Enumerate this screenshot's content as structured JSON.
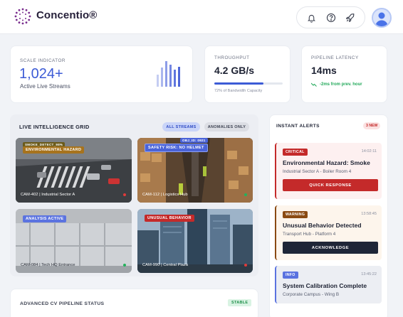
{
  "brand": {
    "name": "Concentio®"
  },
  "header_icons": [
    "bell-icon",
    "help-icon",
    "rocket-icon"
  ],
  "stats": {
    "scale": {
      "label": "SCALE INDICATOR",
      "value": "1,024+",
      "sub": "Active Live Streams"
    },
    "throughput": {
      "label": "THROUGHPUT",
      "value": "4.2 GB/s",
      "sub": "72% of Bandwidth Capacity",
      "fill_pct": 72
    },
    "latency": {
      "label": "PIPELINE LATENCY",
      "value": "14ms",
      "delta": "-2ms from prev. hour"
    }
  },
  "grid": {
    "title": "LIVE INTELLIGENCE GRID",
    "filters": [
      "ALL STREAMS",
      "ANOMALIES ONLY"
    ],
    "tiles": [
      {
        "tag": "ENVIRONMENTAL HAZARD",
        "detect": "SMOKE_DETECT_98%",
        "caption": "CAM-402 | Industrial Sector A",
        "status": "red"
      },
      {
        "tag": "SAFETY RISK: NO HELMET",
        "detect": "OBJ_ID: 0921",
        "caption": "CAM-112 | Logistics Hub",
        "status": "green"
      },
      {
        "tag": "ANALYSIS ACTIVE",
        "detect": "",
        "caption": "CAM-084 | Tech HQ Entrance",
        "status": "green"
      },
      {
        "tag": "UNUSUAL BEHAVIOR",
        "detect": "",
        "caption": "CAM-990 | Central Plaza",
        "status": "red"
      }
    ]
  },
  "alerts": {
    "title": "INSTANT ALERTS",
    "count": "3 NEW",
    "items": [
      {
        "level": "CRITICAL",
        "time": "14:02:11",
        "title": "Environmental Hazard: Smoke",
        "location": "Industrial Sector A - Boiler Room 4",
        "action": "QUICK RESPONSE"
      },
      {
        "level": "WARNING",
        "time": "13:58:45",
        "title": "Unusual Behavior Detected",
        "location": "Transport Hub - Platform 4",
        "action": "ACKNOWLEDGE"
      },
      {
        "level": "INFO",
        "time": "13:45:22",
        "title": "System Calibration Complete",
        "location": "Corporate Campus - Wing B",
        "action": ""
      }
    ]
  },
  "pipeline": {
    "title": "ADVANCED CV PIPELINE STATUS",
    "status": "STABLE"
  },
  "colors": {
    "accent": "#3c5bd6",
    "critical": "#c42a2a",
    "warning": "#8a4a12",
    "info": "#5b73e0",
    "success": "#22a95a"
  }
}
